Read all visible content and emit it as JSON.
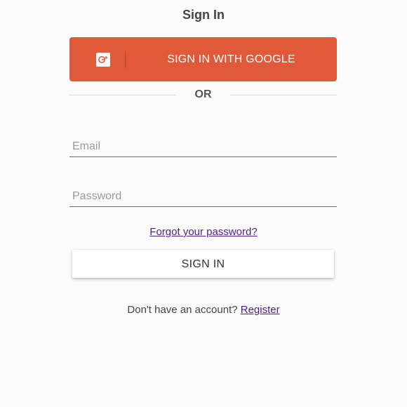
{
  "page": {
    "title": "Sign In"
  },
  "google": {
    "label": "SIGN IN WITH GOOGLE",
    "icon": "google-plus-icon",
    "color": "#e05a3a"
  },
  "divider": {
    "text": "OR"
  },
  "form": {
    "email_placeholder": "Email",
    "email_value": "",
    "password_placeholder": "Password",
    "password_value": ""
  },
  "links": {
    "forgot_password": "Forgot your password?",
    "no_account_text": "Don't have an account?",
    "register": "Register",
    "color": "#551a8b"
  },
  "actions": {
    "sign_in_label": "SIGN IN"
  }
}
